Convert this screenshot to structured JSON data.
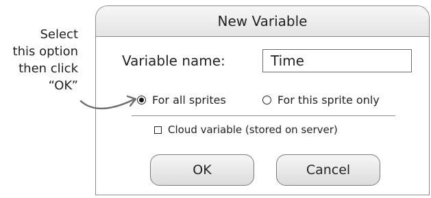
{
  "annotation": {
    "lines": [
      "Select",
      "this option",
      "then click",
      "“OK”"
    ]
  },
  "dialog": {
    "title": "New Variable",
    "name_label": "Variable name:",
    "name_value": "Time",
    "radio_all": "For all sprites",
    "radio_all_selected": true,
    "radio_this": "For this sprite only",
    "radio_this_selected": false,
    "cloud_label": "Cloud variable (stored on server)",
    "cloud_checked": false,
    "ok_label": "OK",
    "cancel_label": "Cancel"
  },
  "colors": {
    "border": "#8a8a8a",
    "arrow": "#6e6e6e",
    "text": "#222222"
  },
  "icons": {
    "annotation_arrow": "curved-arrow-icon",
    "radio_selected": "radio-checked-icon",
    "radio_unselected": "radio-unchecked-icon",
    "checkbox": "checkbox-unchecked-icon"
  }
}
